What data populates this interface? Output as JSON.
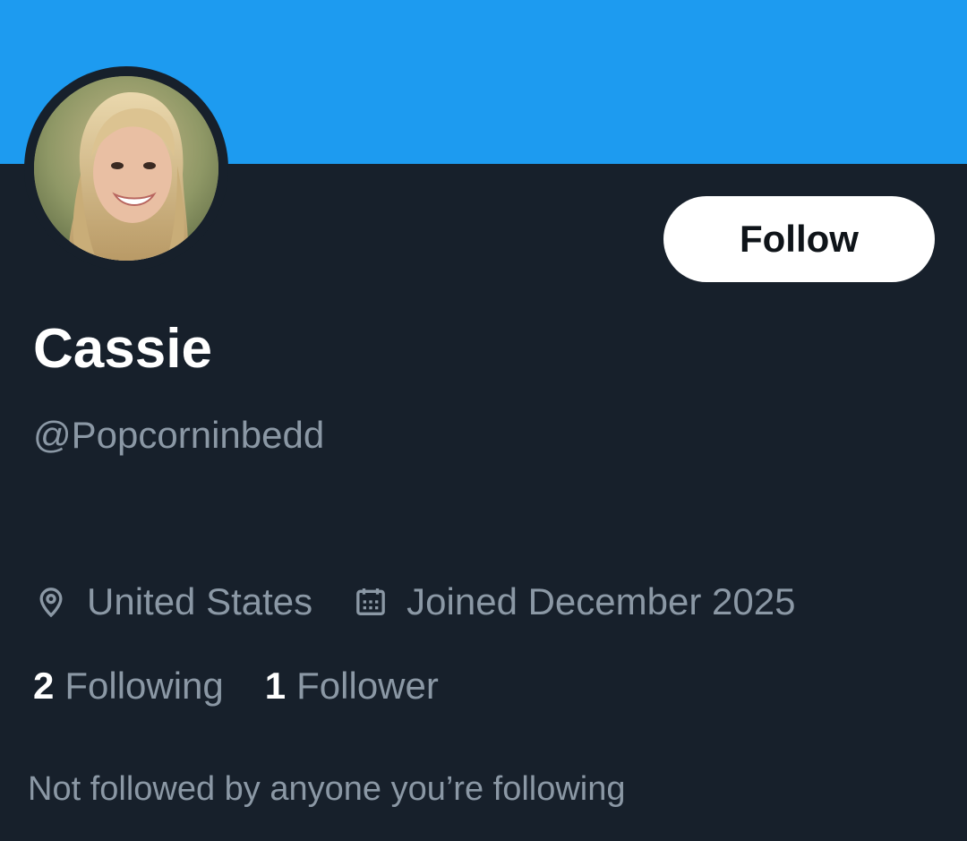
{
  "colors": {
    "banner": "#1d9bf0",
    "background": "#17202b",
    "primary_text": "#ffffff",
    "secondary_text": "#8b98a5",
    "button_bg": "#ffffff",
    "button_text": "#0f1419"
  },
  "profile": {
    "display_name": "Cassie",
    "handle": "@Popcorninbedd",
    "follow_label": "Follow",
    "location": "United States",
    "location_icon": "location-pin-icon",
    "joined": "Joined December 2025",
    "joined_icon": "calendar-icon",
    "avatar": "profile-photo"
  },
  "stats": {
    "following_count": "2",
    "following_label": "Following",
    "followers_count": "1",
    "followers_label": "Follower"
  },
  "followed_by_text": "Not followed by anyone you’re following"
}
